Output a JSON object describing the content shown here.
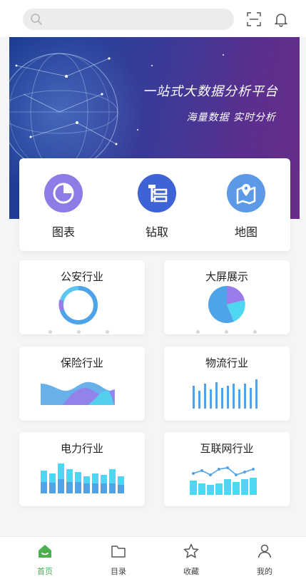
{
  "header": {
    "search_placeholder": "",
    "scan_icon": "scan-icon",
    "bell_icon": "bell-icon"
  },
  "banner": {
    "title": "一站式大数据分析平台",
    "subtitle": "海量数据 实时分析"
  },
  "quick_actions": [
    {
      "label": "图表",
      "icon": "pie-chart-icon",
      "color": "#8e7be6"
    },
    {
      "label": "钻取",
      "icon": "drill-icon",
      "color": "#3f63d6"
    },
    {
      "label": "地图",
      "icon": "map-icon",
      "color": "#5c9ae8"
    }
  ],
  "industries": [
    {
      "label": "公安行业",
      "icon": "donut-chart-icon"
    },
    {
      "label": "大屏展示",
      "icon": "pie-chart-icon"
    },
    {
      "label": "保险行业",
      "icon": "area-chart-icon"
    },
    {
      "label": "物流行业",
      "icon": "bar-chart-icon"
    },
    {
      "label": "电力行业",
      "icon": "stacked-bar-chart-icon"
    },
    {
      "label": "互联网行业",
      "icon": "line-bar-chart-icon"
    }
  ],
  "tabbar": {
    "items": [
      {
        "label": "首页",
        "icon": "home-icon",
        "active": true
      },
      {
        "label": "目录",
        "icon": "folder-icon",
        "active": false
      },
      {
        "label": "收藏",
        "icon": "star-icon",
        "active": false
      },
      {
        "label": "我的",
        "icon": "user-icon",
        "active": false
      }
    ]
  },
  "colors": {
    "accent": "#4caf50",
    "banner_start": "#1b3c92",
    "banner_end": "#6a2c8a",
    "chart_blue": "#4fa3e8",
    "chart_cyan": "#4fd6f0",
    "chart_purple": "#9a7bea"
  }
}
